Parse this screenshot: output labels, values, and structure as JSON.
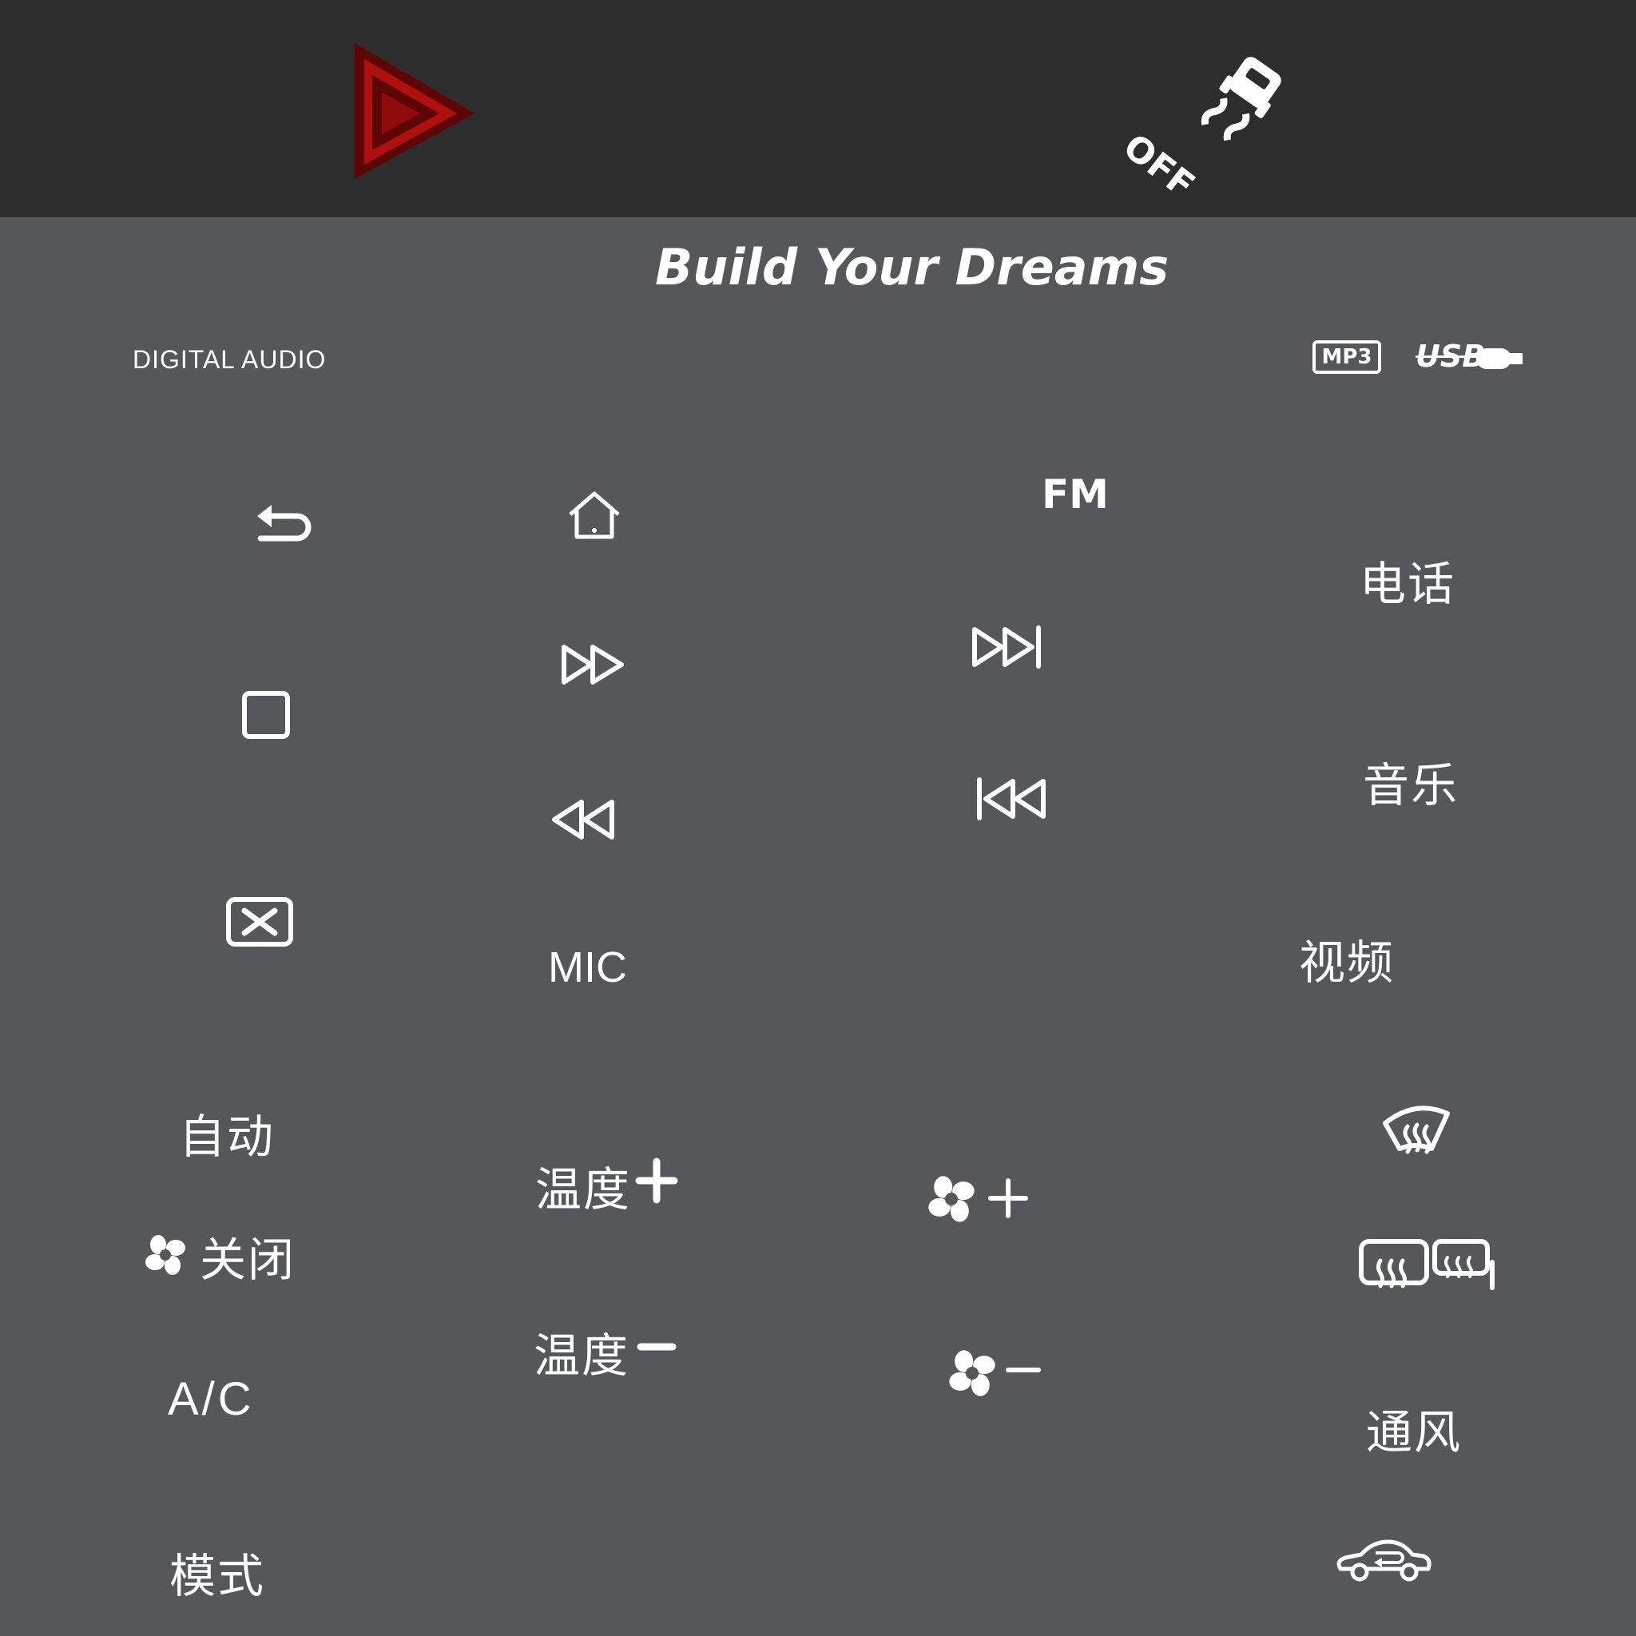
{
  "colors": {
    "top_bar": "#2d2d2e",
    "panel": "#56575b",
    "hazard_red": "#8e0c0c",
    "foreground": "#ffffff"
  },
  "top_bar": {
    "hazard_button": {
      "icon": "hazard-warning-triangle-icon"
    },
    "traction_control_button": {
      "icon": "traction-control-off-icon",
      "label": "OFF"
    }
  },
  "header": {
    "tagline": "Build Your Dreams",
    "left_label": "DIGITAL AUDIO",
    "badges": {
      "mp3": "MP3",
      "usb": "USB"
    }
  },
  "media": {
    "back": {
      "icon": "back-arrow-icon"
    },
    "home": {
      "icon": "home-icon"
    },
    "fm": "FM",
    "stop": {
      "icon": "stop-square-icon"
    },
    "fast_forward": {
      "icon": "fast-forward-icon"
    },
    "next_track": {
      "icon": "skip-next-icon"
    },
    "rewind": {
      "icon": "rewind-icon"
    },
    "previous_track": {
      "icon": "skip-previous-icon"
    },
    "mute": {
      "icon": "mute-x-icon"
    },
    "mic": "MIC",
    "phone": "电话",
    "music": "音乐",
    "video": "视频"
  },
  "climate": {
    "auto": "自动",
    "fan_off": "关闭",
    "ac": "A/C",
    "mode": "模式",
    "temp_up": "温度",
    "temp_down": "温度",
    "fan_up": {
      "icon": "fan-icon"
    },
    "fan_down": {
      "icon": "fan-icon"
    },
    "front_defrost": {
      "icon": "front-defrost-icon"
    },
    "rear_defrost": {
      "icon": "rear-defrost-icon"
    },
    "ventilation": "通风",
    "recirculation": {
      "icon": "air-recirculation-icon"
    }
  }
}
